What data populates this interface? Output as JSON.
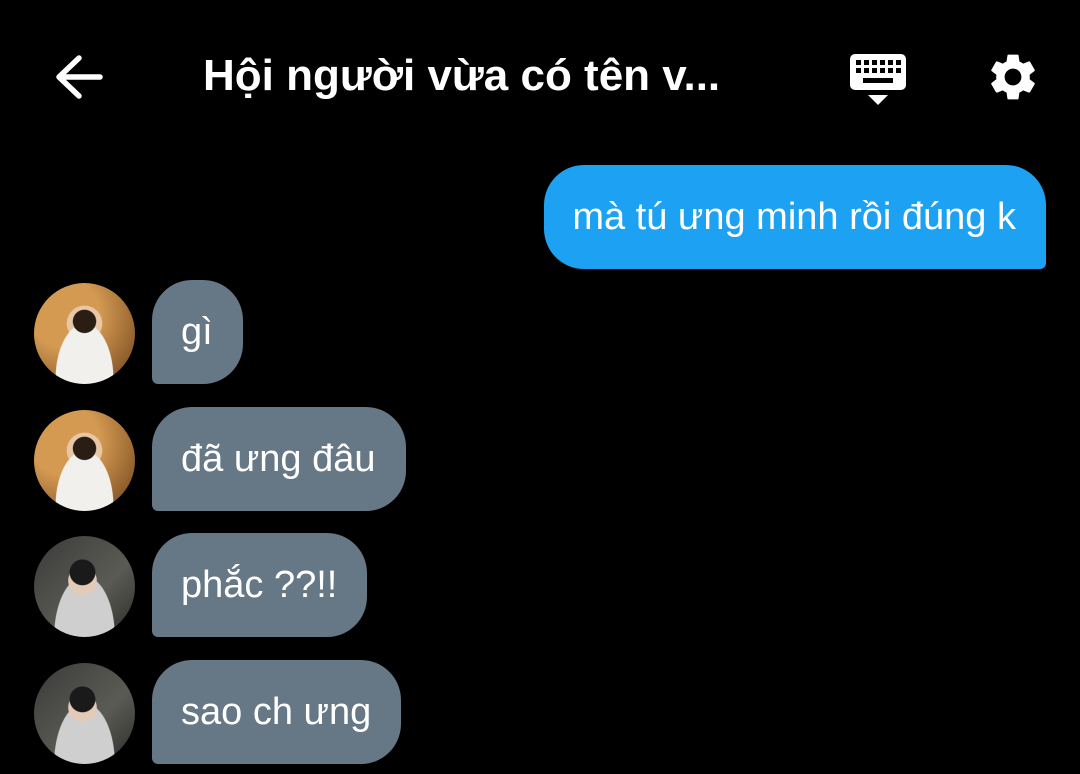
{
  "header": {
    "title": "Hội người vừa có tên v...",
    "back_icon": "arrow-left-icon",
    "keyboard_icon": "keyboard-hide-icon",
    "settings_icon": "gear-icon"
  },
  "colors": {
    "background": "#000000",
    "outgoing_bubble": "#1da1f2",
    "incoming_bubble": "#667786",
    "text": "#ffffff"
  },
  "messages": [
    {
      "direction": "outgoing",
      "text": "mà tú ưng minh rồi đúng k"
    },
    {
      "direction": "incoming",
      "text": "gì",
      "avatar": "avatar-1"
    },
    {
      "direction": "incoming",
      "text": "đã ưng đâu",
      "avatar": "avatar-1"
    },
    {
      "direction": "incoming",
      "text": "phắc ??!!",
      "avatar": "avatar-2"
    },
    {
      "direction": "incoming",
      "text": "sao ch ưng",
      "avatar": "avatar-2"
    }
  ]
}
